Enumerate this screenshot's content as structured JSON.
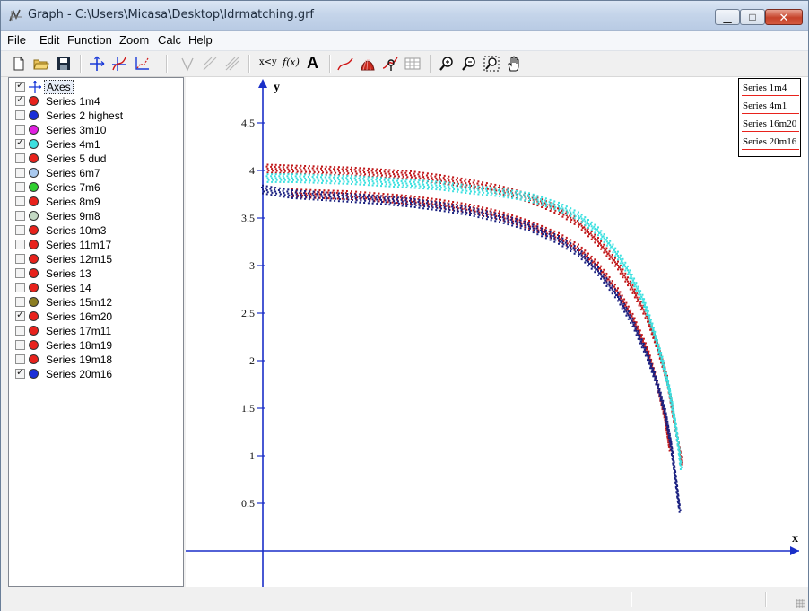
{
  "window": {
    "title": "Graph - C:\\Users\\Micasa\\Desktop\\ldrmatching.grf"
  },
  "caption_buttons": {
    "minimize": "▁",
    "maximize": "□",
    "close": "✕"
  },
  "menu": [
    "File",
    "Edit",
    "Function",
    "Zoom",
    "Calc",
    "Help"
  ],
  "toolbar_icons": [
    "new-file-icon",
    "open-folder-icon",
    "save-icon",
    "axes-icon",
    "insert-function-icon",
    "point-series-icon",
    "tangent-icon",
    "shade-icon",
    "relation-icon",
    "xy-label-icon",
    "fx-label-icon",
    "text-icon",
    "trendline-icon",
    "shading-icon",
    "evaluate-icon",
    "table-icon",
    "zoom-in-icon",
    "zoom-out-icon",
    "zoom-window-icon",
    "hand-move-icon"
  ],
  "toolbar_text": {
    "xy": "x<y",
    "fx": "f(x)",
    "text": "A"
  },
  "sidebar": {
    "axes_label": "Axes",
    "items": [
      {
        "label": "Series 1m4",
        "checked": true,
        "color": "#e8221c"
      },
      {
        "label": "Series 2 highest",
        "checked": false,
        "color": "#1a2fd8"
      },
      {
        "label": "Series 3m10",
        "checked": false,
        "color": "#e020e0"
      },
      {
        "label": "Series 4m1",
        "checked": true,
        "color": "#3de0e0"
      },
      {
        "label": "Series 5 dud",
        "checked": false,
        "color": "#e8221c"
      },
      {
        "label": "Series 6m7",
        "checked": false,
        "color": "#a9c9ef"
      },
      {
        "label": "Series 7m6",
        "checked": false,
        "color": "#2fcf2f"
      },
      {
        "label": "Series 8m9",
        "checked": false,
        "color": "#e8221c"
      },
      {
        "label": "Series 9m8",
        "checked": false,
        "color": "#c4d9c4"
      },
      {
        "label": "Series 10m3",
        "checked": false,
        "color": "#e8221c"
      },
      {
        "label": "Series 11m17",
        "checked": false,
        "color": "#e8221c"
      },
      {
        "label": "Series 12m15",
        "checked": false,
        "color": "#e8221c"
      },
      {
        "label": "Series 13",
        "checked": false,
        "color": "#e8221c"
      },
      {
        "label": "Series 14",
        "checked": false,
        "color": "#e8221c"
      },
      {
        "label": "Series 15m12",
        "checked": false,
        "color": "#8b7d22"
      },
      {
        "label": "Series 16m20",
        "checked": true,
        "color": "#e8221c"
      },
      {
        "label": "Series 17m11",
        "checked": false,
        "color": "#e8221c"
      },
      {
        "label": "Series 18m19",
        "checked": false,
        "color": "#e8221c"
      },
      {
        "label": "Series 19m18",
        "checked": false,
        "color": "#e8221c"
      },
      {
        "label": "Series 20m16",
        "checked": true,
        "color": "#1a2fd8"
      }
    ]
  },
  "legend": [
    {
      "label": "Series 1m4",
      "color": "#e8221c"
    },
    {
      "label": "Series 4m1",
      "color": "#e8221c"
    },
    {
      "label": "Series 16m20",
      "color": "#e8221c"
    },
    {
      "label": "Series 20m16",
      "color": "#e8221c"
    }
  ],
  "chart_data": {
    "type": "scatter",
    "xlabel": "x",
    "ylabel": "y",
    "yticks": [
      "0.5",
      "1",
      "1.5",
      "2",
      "2.5",
      "3",
      "3.5",
      "4",
      "4.5"
    ],
    "ylim": [
      0,
      4.9
    ],
    "xlim": [
      -0.8,
      5.6
    ],
    "series": [
      {
        "name": "Series 1m4",
        "color": "#c0181a",
        "points": [
          [
            0.05,
            4.02
          ],
          [
            0.3,
            4.01
          ],
          [
            0.6,
            4.0
          ],
          [
            0.9,
            3.99
          ],
          [
            1.2,
            3.97
          ],
          [
            1.5,
            3.95
          ],
          [
            1.8,
            3.91
          ],
          [
            2.1,
            3.86
          ],
          [
            2.4,
            3.8
          ],
          [
            2.7,
            3.71
          ],
          [
            3.0,
            3.58
          ],
          [
            3.2,
            3.45
          ],
          [
            3.4,
            3.25
          ],
          [
            3.6,
            3.0
          ],
          [
            3.75,
            2.75
          ],
          [
            3.9,
            2.45
          ],
          [
            4.0,
            2.15
          ],
          [
            4.1,
            1.8
          ],
          [
            4.15,
            1.5
          ],
          [
            4.2,
            1.2
          ],
          [
            4.25,
            0.9
          ]
        ]
      },
      {
        "name": "Series 4m1",
        "color": "#3de0e0",
        "points": [
          [
            0.05,
            3.92
          ],
          [
            0.3,
            3.92
          ],
          [
            0.6,
            3.91
          ],
          [
            0.9,
            3.9
          ],
          [
            1.2,
            3.88
          ],
          [
            1.5,
            3.86
          ],
          [
            1.8,
            3.84
          ],
          [
            2.1,
            3.8
          ],
          [
            2.4,
            3.77
          ],
          [
            2.7,
            3.72
          ],
          [
            3.0,
            3.62
          ],
          [
            3.2,
            3.52
          ],
          [
            3.4,
            3.36
          ],
          [
            3.55,
            3.18
          ],
          [
            3.7,
            2.95
          ],
          [
            3.85,
            2.65
          ],
          [
            3.95,
            2.35
          ],
          [
            4.05,
            2.0
          ],
          [
            4.12,
            1.7
          ],
          [
            4.18,
            1.35
          ],
          [
            4.22,
            1.05
          ],
          [
            4.24,
            0.85
          ]
        ]
      },
      {
        "name": "Series 16m20",
        "color": "#c0181a",
        "points": [
          [
            0.3,
            3.76
          ],
          [
            0.9,
            3.74
          ],
          [
            1.5,
            3.69
          ],
          [
            1.8,
            3.65
          ],
          [
            2.1,
            3.6
          ],
          [
            2.4,
            3.53
          ],
          [
            2.7,
            3.43
          ],
          [
            3.0,
            3.3
          ],
          [
            3.2,
            3.18
          ],
          [
            3.4,
            2.99
          ],
          [
            3.6,
            2.72
          ],
          [
            3.75,
            2.45
          ],
          [
            3.9,
            2.1
          ],
          [
            4.0,
            1.75
          ],
          [
            4.08,
            1.4
          ],
          [
            4.13,
            1.05
          ]
        ]
      },
      {
        "name": "Series 20m16",
        "color": "#1a2080",
        "points": [
          [
            0.0,
            3.8
          ],
          [
            0.3,
            3.75
          ],
          [
            0.6,
            3.73
          ],
          [
            0.9,
            3.71
          ],
          [
            1.2,
            3.69
          ],
          [
            1.5,
            3.66
          ],
          [
            1.8,
            3.62
          ],
          [
            2.1,
            3.57
          ],
          [
            2.4,
            3.5
          ],
          [
            2.7,
            3.41
          ],
          [
            3.0,
            3.27
          ],
          [
            3.2,
            3.14
          ],
          [
            3.4,
            2.94
          ],
          [
            3.6,
            2.67
          ],
          [
            3.75,
            2.4
          ],
          [
            3.9,
            2.05
          ],
          [
            4.0,
            1.75
          ],
          [
            4.08,
            1.45
          ],
          [
            4.14,
            1.1
          ],
          [
            4.18,
            0.8
          ],
          [
            4.21,
            0.55
          ],
          [
            4.23,
            0.4
          ]
        ]
      }
    ]
  }
}
